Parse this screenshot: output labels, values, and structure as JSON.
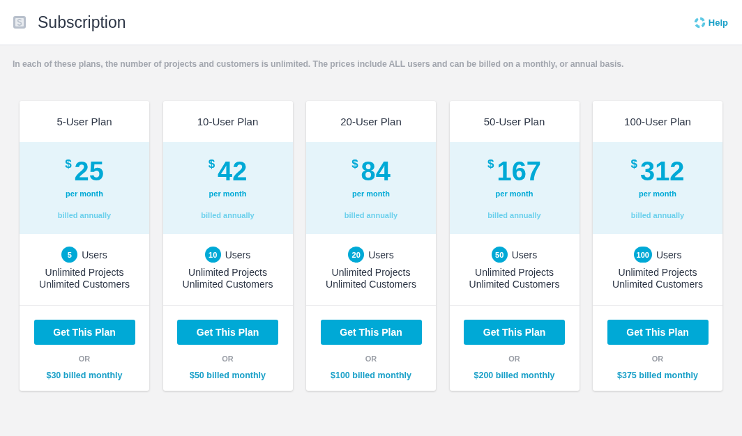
{
  "header": {
    "title": "Subscription",
    "help": "Help"
  },
  "intro": "In each of these plans, the number of projects and customers is unlimited. The prices include ALL users and can be billed on a monthly, or annual basis.",
  "plans": [
    {
      "name": "5-User Plan",
      "currency": "$",
      "price": "25",
      "period": "per month",
      "billing": "billed annually",
      "users": "5",
      "users_label": "Users",
      "features": [
        "Unlimited Projects",
        "Unlimited Customers"
      ],
      "button": "Get This Plan",
      "or": "OR",
      "monthly": "$30 billed monthly"
    },
    {
      "name": "10-User Plan",
      "currency": "$",
      "price": "42",
      "period": "per month",
      "billing": "billed annually",
      "users": "10",
      "users_label": "Users",
      "features": [
        "Unlimited Projects",
        "Unlimited Customers"
      ],
      "button": "Get This Plan",
      "or": "OR",
      "monthly": "$50 billed monthly"
    },
    {
      "name": "20-User Plan",
      "currency": "$",
      "price": "84",
      "period": "per month",
      "billing": "billed annually",
      "users": "20",
      "users_label": "Users",
      "features": [
        "Unlimited Projects",
        "Unlimited Customers"
      ],
      "button": "Get This Plan",
      "or": "OR",
      "monthly": "$100 billed monthly"
    },
    {
      "name": "50-User Plan",
      "currency": "$",
      "price": "167",
      "period": "per month",
      "billing": "billed annually",
      "users": "50",
      "users_label": "Users",
      "features": [
        "Unlimited Projects",
        "Unlimited Customers"
      ],
      "button": "Get This Plan",
      "or": "OR",
      "monthly": "$200 billed monthly"
    },
    {
      "name": "100-User Plan",
      "currency": "$",
      "price": "312",
      "period": "per month",
      "billing": "billed annually",
      "users": "100",
      "users_label": "Users",
      "features": [
        "Unlimited Projects",
        "Unlimited Customers"
      ],
      "button": "Get This Plan",
      "or": "OR",
      "monthly": "$375 billed monthly"
    }
  ]
}
